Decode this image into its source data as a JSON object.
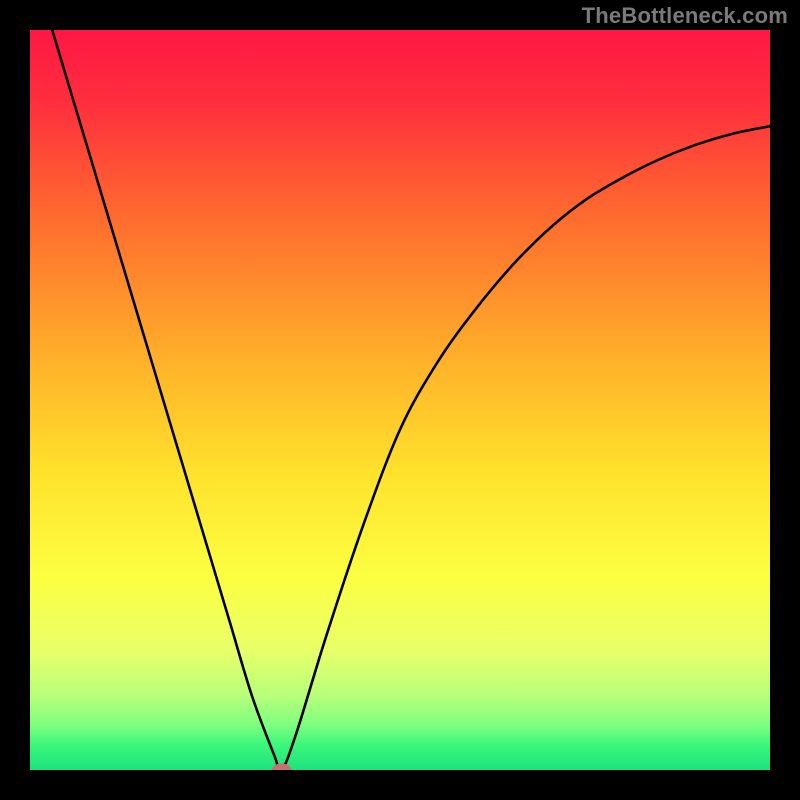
{
  "watermark": "TheBottleneck.com",
  "chart_data": {
    "type": "line",
    "title": "",
    "xlabel": "",
    "ylabel": "",
    "xlim": [
      0,
      100
    ],
    "ylim": [
      0,
      100
    ],
    "gradient_stops": [
      {
        "t": 0.0,
        "color": "#ff1744"
      },
      {
        "t": 0.1,
        "color": "#ff2f3e"
      },
      {
        "t": 0.25,
        "color": "#ff6a2f"
      },
      {
        "t": 0.45,
        "color": "#ffb22a"
      },
      {
        "t": 0.6,
        "color": "#ffe22c"
      },
      {
        "t": 0.74,
        "color": "#fcff41"
      },
      {
        "t": 0.84,
        "color": "#e8ff6a"
      },
      {
        "t": 0.9,
        "color": "#b6ff7a"
      },
      {
        "t": 0.94,
        "color": "#7dff80"
      },
      {
        "t": 0.965,
        "color": "#3cf77a"
      },
      {
        "t": 1.0,
        "color": "#1de27d"
      }
    ],
    "series": [
      {
        "name": "curve",
        "color": "#000000",
        "x": [
          3,
          6,
          9,
          12,
          15,
          18,
          21,
          24,
          27,
          30,
          33,
          34,
          36,
          40,
          45,
          50,
          55,
          60,
          65,
          70,
          75,
          80,
          85,
          90,
          95,
          100
        ],
        "y": [
          100,
          90,
          80,
          70,
          60,
          50,
          40,
          30,
          20,
          10,
          2,
          0,
          5,
          18,
          33,
          46,
          55,
          62,
          68,
          73,
          77,
          80,
          82.5,
          84.5,
          86,
          87
        ]
      }
    ],
    "marker": {
      "x": 34,
      "y": 0,
      "rx": 1.3,
      "ry": 0.9,
      "color": "#cc6f70"
    }
  }
}
